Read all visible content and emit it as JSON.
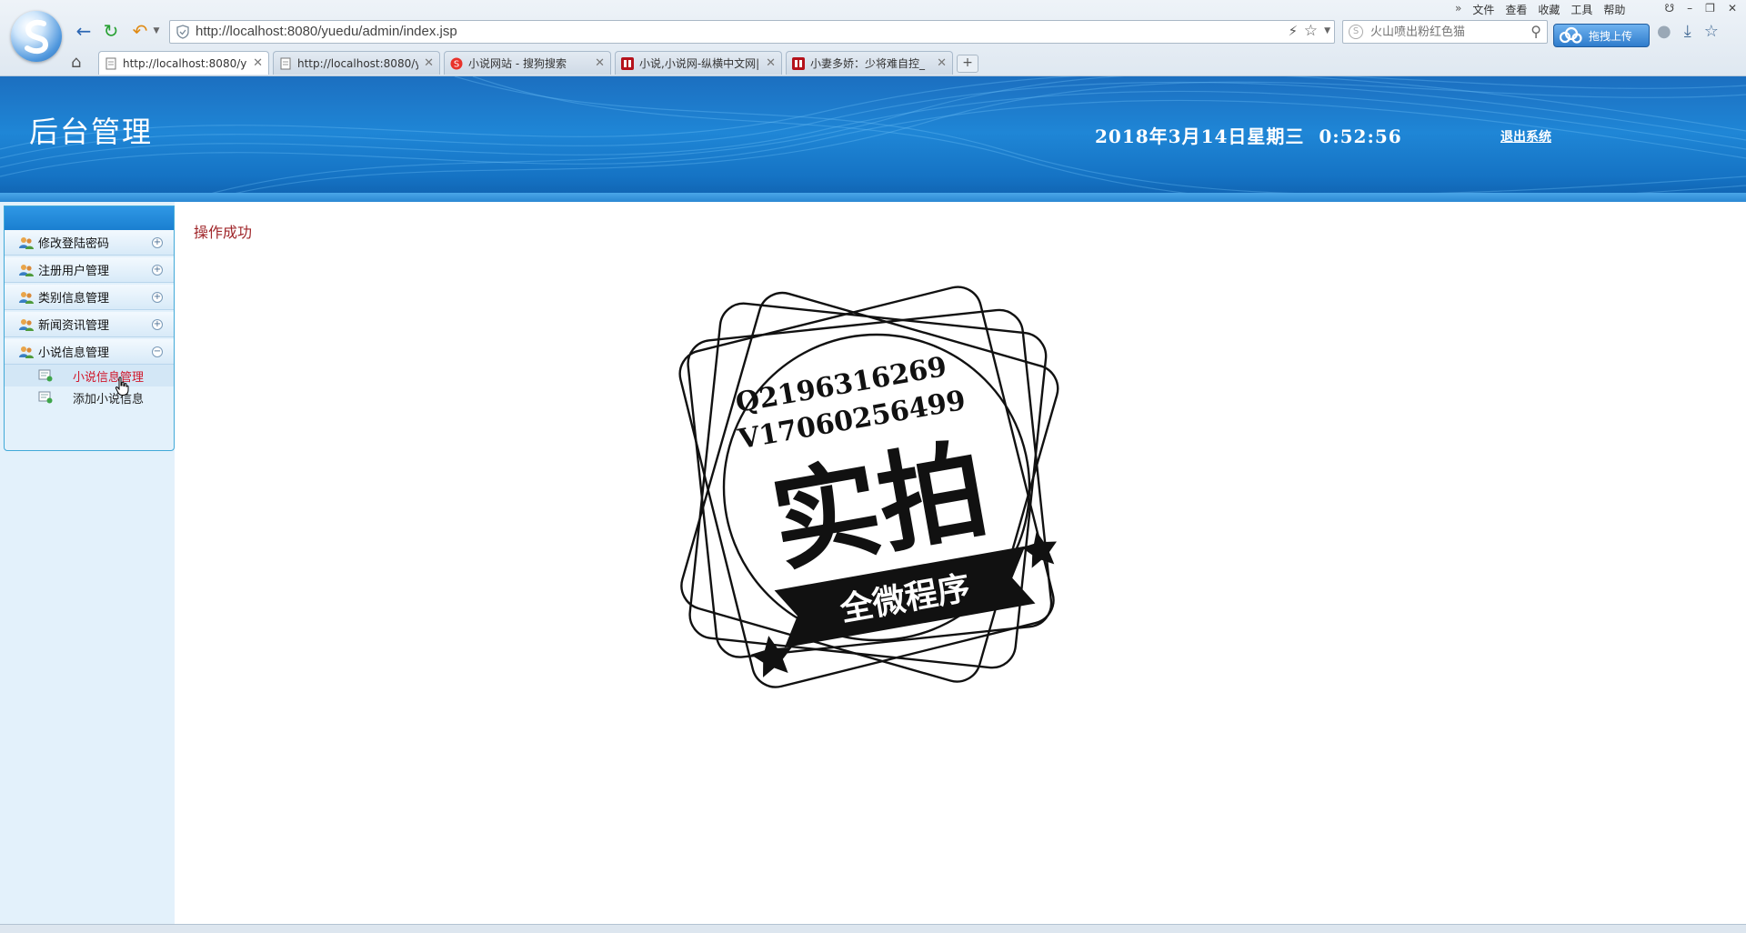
{
  "browser": {
    "url": "http://localhost:8080/yuedu/admin/index.jsp",
    "search_placeholder": "火山喷出粉红色猫",
    "upload_label": "拖拽上传",
    "menu": [
      "文件",
      "查看",
      "收藏",
      "工具",
      "帮助"
    ],
    "tabs": [
      {
        "label": "http://localhost:8080/y",
        "active": true,
        "favicon": "page-icon"
      },
      {
        "label": "http://localhost:8080/y",
        "active": false,
        "favicon": "page-icon"
      },
      {
        "label": "小说网站 - 搜狗搜索",
        "active": false,
        "favicon": "sogou-icon"
      },
      {
        "label": "小说,小说网-纵横中文网|",
        "active": false,
        "favicon": "zongheng-icon"
      },
      {
        "label": "小妻多娇：少将难自控_",
        "active": false,
        "favicon": "zongheng-icon"
      }
    ],
    "new_tab_symbol": "+"
  },
  "header": {
    "title": "后台管理",
    "datetime": "2018年3月14日星期三  0:52:56",
    "logout": "退出系统"
  },
  "sidebar": {
    "items": [
      {
        "label": "修改登陆密码",
        "toggle": "+"
      },
      {
        "label": "注册用户管理",
        "toggle": "+"
      },
      {
        "label": "类别信息管理",
        "toggle": "+"
      },
      {
        "label": "新闻资讯管理",
        "toggle": "+"
      },
      {
        "label": "小说信息管理",
        "toggle": "−",
        "expanded": true
      }
    ],
    "sub_items": [
      {
        "label": "小说信息管理",
        "active": true
      },
      {
        "label": "添加小说信息",
        "active": false
      }
    ]
  },
  "main": {
    "message": "操作成功"
  },
  "watermark": {
    "line1": "Q2196316269",
    "line2": "V17060256499",
    "big": "实拍",
    "banner": "全微程序"
  },
  "colors": {
    "header_blue": "#1f86d6",
    "message_red": "#a0262a",
    "active_link_red": "#d0162a",
    "sidebar_bg": "#e3f1fb"
  }
}
